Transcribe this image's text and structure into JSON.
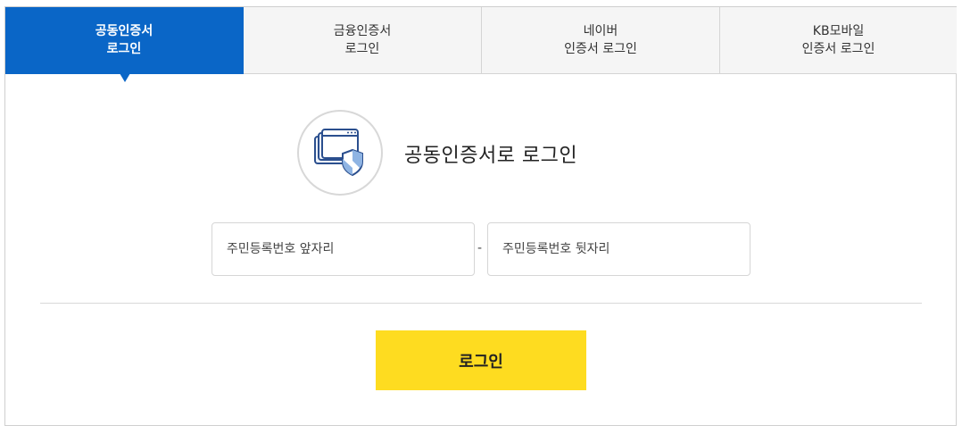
{
  "tabs": [
    {
      "line1": "공동인증서",
      "line2": "로그인",
      "active": true
    },
    {
      "line1": "금융인증서",
      "line2": "로그인",
      "active": false
    },
    {
      "line1": "네이버",
      "line2": "인증서 로그인",
      "active": false
    },
    {
      "line1": "KB모바일",
      "line2": "인증서 로그인",
      "active": false
    }
  ],
  "login": {
    "icon": "certificate-shield-icon",
    "title": "공동인증서로 로그인",
    "rrn_front_placeholder": "주민등록번호 앞자리",
    "separator": "-",
    "rrn_back_placeholder": "주민등록번호 뒷자리",
    "button_label": "로그인"
  },
  "colors": {
    "active_tab": "#0a66c7",
    "login_button": "#fedc20",
    "icon_accent": "#2b4f8e"
  }
}
